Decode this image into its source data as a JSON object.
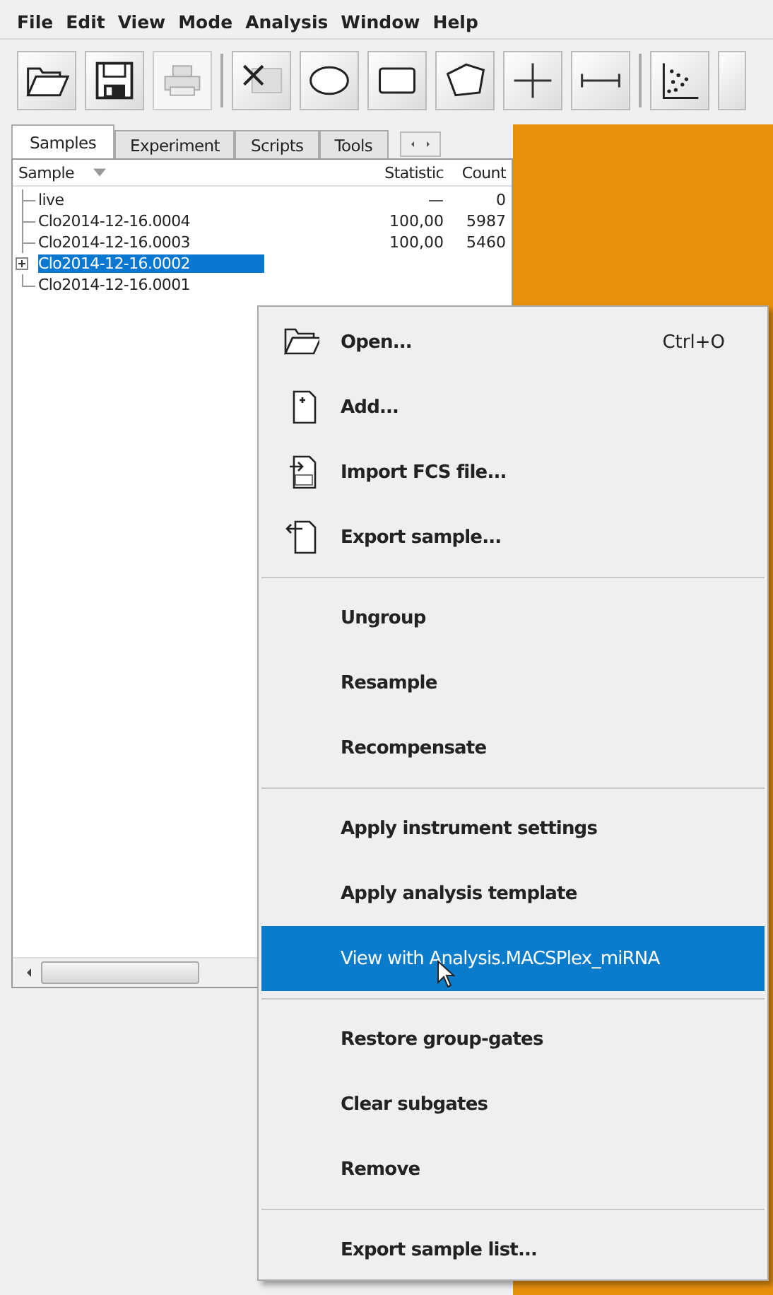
{
  "menu_bar": [
    "File",
    "Edit",
    "View",
    "Mode",
    "Analysis",
    "Window",
    "Help"
  ],
  "toolbar": [
    {
      "kind": "open",
      "disabled": false
    },
    {
      "kind": "save",
      "disabled": false
    },
    {
      "kind": "print",
      "disabled": true
    },
    {
      "kind": "delete",
      "disabled": false
    },
    {
      "kind": "ellipse",
      "disabled": false
    },
    {
      "kind": "rectangle",
      "disabled": false
    },
    {
      "kind": "polygon",
      "disabled": false
    },
    {
      "kind": "quadrant",
      "disabled": false
    },
    {
      "kind": "range",
      "disabled": false
    },
    {
      "kind": "dotplot",
      "disabled": false
    }
  ],
  "tabs": [
    {
      "label": "Samples",
      "selected": true
    },
    {
      "label": "Experiment",
      "selected": false
    },
    {
      "label": "Scripts",
      "selected": false
    },
    {
      "label": "Tools",
      "selected": false
    }
  ],
  "tree": {
    "columns": [
      "Sample",
      "Statistic",
      "Count"
    ],
    "rows": [
      {
        "name": "live",
        "statistic": "—",
        "count": "0",
        "selected": false,
        "expandable": false
      },
      {
        "name": "Clo2014-12-16.0004",
        "statistic": "100,00",
        "count": "5987",
        "selected": false,
        "expandable": false
      },
      {
        "name": "Clo2014-12-16.0003",
        "statistic": "100,00",
        "count": "5460",
        "selected": false,
        "expandable": false
      },
      {
        "name": "Clo2014-12-16.0002",
        "selected": true,
        "expandable": true
      },
      {
        "name": "Clo2014-12-16.0001",
        "selected": false,
        "expandable": false
      }
    ]
  },
  "context_menu": [
    {
      "kind": "item",
      "label": "Open...",
      "shortcut": "Ctrl+O",
      "selected": false
    },
    {
      "kind": "item",
      "label": "Add...",
      "selected": false
    },
    {
      "kind": "item",
      "label": "Import FCS file...",
      "selected": false
    },
    {
      "kind": "item",
      "label": "Export sample...",
      "selected": false
    },
    {
      "kind": "separator"
    },
    {
      "kind": "item",
      "label": "Ungroup",
      "selected": false
    },
    {
      "kind": "item",
      "label": "Resample",
      "selected": false
    },
    {
      "kind": "item",
      "label": "Recompensate",
      "selected": false
    },
    {
      "kind": "separator"
    },
    {
      "kind": "item",
      "label": "Apply instrument settings",
      "selected": false
    },
    {
      "kind": "item",
      "label": "Apply analysis template",
      "selected": false
    },
    {
      "kind": "item",
      "label": "View with Analysis.MACSPlex_miRNA",
      "selected": true
    },
    {
      "kind": "separator"
    },
    {
      "kind": "item",
      "label": "Restore group-gates",
      "selected": false
    },
    {
      "kind": "item",
      "label": "Clear subgates",
      "selected": false
    },
    {
      "kind": "item",
      "label": "Remove",
      "selected": false
    },
    {
      "kind": "separator"
    },
    {
      "kind": "item",
      "label": "Export sample list...",
      "selected": false
    }
  ]
}
